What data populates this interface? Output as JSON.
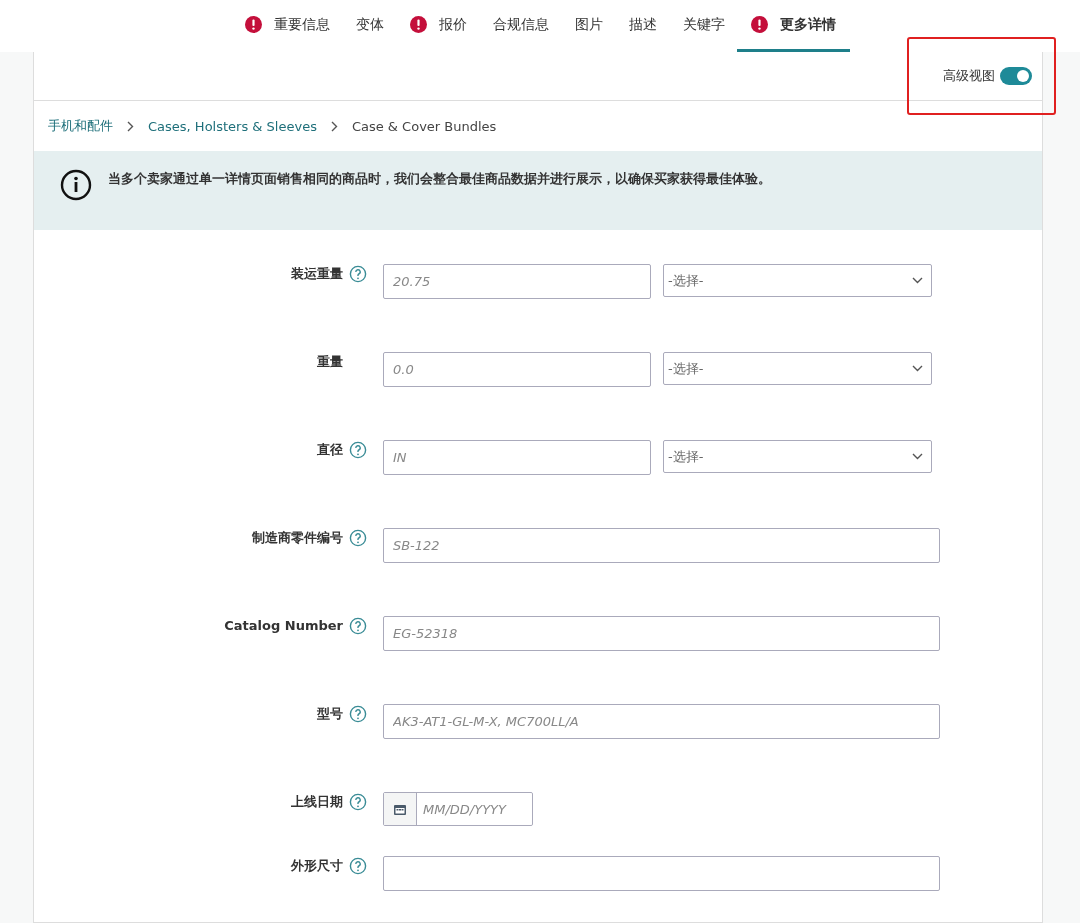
{
  "tabs": [
    {
      "label": "重要信息",
      "error": true,
      "selected": false
    },
    {
      "label": "变体",
      "error": false,
      "selected": false
    },
    {
      "label": "报价",
      "error": true,
      "selected": false
    },
    {
      "label": "合规信息",
      "error": false,
      "selected": false
    },
    {
      "label": "图片",
      "error": false,
      "selected": false
    },
    {
      "label": "描述",
      "error": false,
      "selected": false
    },
    {
      "label": "关键字",
      "error": false,
      "selected": false
    },
    {
      "label": "更多详情",
      "error": true,
      "selected": true
    }
  ],
  "advanced_view": {
    "label": "高级视图",
    "on": true,
    "highlighted": true
  },
  "breadcrumb": [
    {
      "label": "手机和配件",
      "kind": "link"
    },
    {
      "label": "Cases, Holsters & Sleeves",
      "kind": "link"
    },
    {
      "label": "Case & Cover Bundles",
      "kind": "current"
    }
  ],
  "notice": "当多个卖家通过单一详情页面销售相同的商品时，我们会整合最佳商品数据并进行展示，以确保买家获得最佳体验。",
  "fields": [
    {
      "kind": "unit",
      "label": "装运重量",
      "help": true,
      "placeholder": "20.75",
      "select": "-选择-"
    },
    {
      "kind": "unit",
      "label": "重量",
      "help": false,
      "placeholder": "0.0",
      "select": "-选择-"
    },
    {
      "kind": "unit",
      "label": "直径",
      "help": true,
      "placeholder": "IN",
      "select": "-选择-"
    },
    {
      "kind": "text",
      "label": "制造商零件编号",
      "help": true,
      "placeholder": "SB-122"
    },
    {
      "kind": "text",
      "label": "Catalog Number",
      "help": true,
      "placeholder": "EG-52318"
    },
    {
      "kind": "text",
      "label": "型号",
      "help": true,
      "placeholder": "AK3-AT1-GL-M-X, MC700LL/A"
    },
    {
      "kind": "date",
      "label": "上线日期",
      "help": true,
      "placeholder": "MM/DD/YYYY"
    },
    {
      "kind": "text",
      "label": "外形尺寸",
      "help": true
    }
  ]
}
